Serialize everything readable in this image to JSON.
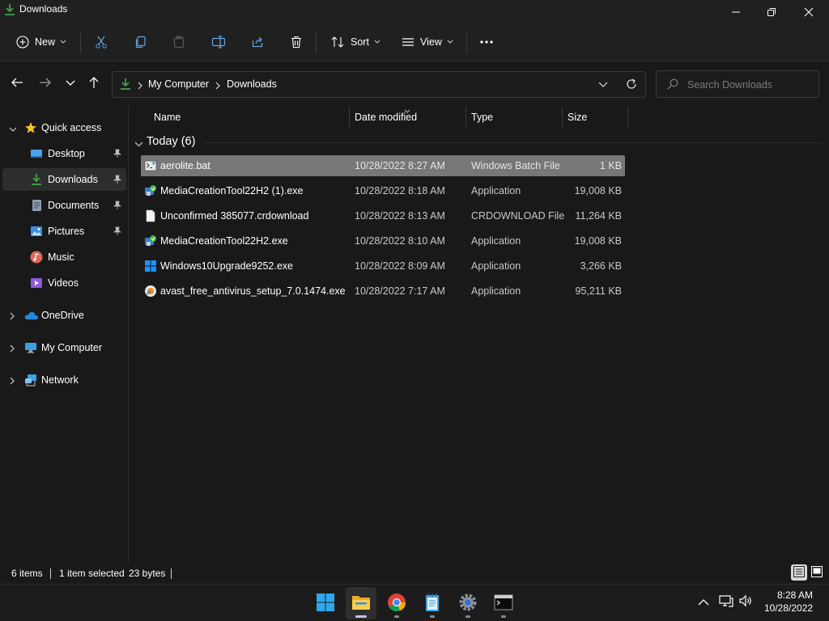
{
  "window": {
    "title": "Downloads"
  },
  "toolbar": {
    "new_label": "New",
    "sort_label": "Sort",
    "view_label": "View"
  },
  "address": {
    "crumbs": [
      "My Computer",
      "Downloads"
    ]
  },
  "search": {
    "placeholder": "Search Downloads"
  },
  "sidebar": {
    "quick_access": "Quick access",
    "items": [
      {
        "label": "Desktop",
        "icon": "desktop-icon",
        "pinned": true
      },
      {
        "label": "Downloads",
        "icon": "download-icon",
        "pinned": true,
        "selected": true
      },
      {
        "label": "Documents",
        "icon": "document-icon",
        "pinned": true
      },
      {
        "label": "Pictures",
        "icon": "pictures-icon",
        "pinned": true
      },
      {
        "label": "Music",
        "icon": "music-icon"
      },
      {
        "label": "Videos",
        "icon": "videos-icon"
      }
    ],
    "roots": [
      {
        "label": "OneDrive",
        "icon": "cloud-icon"
      },
      {
        "label": "My Computer",
        "icon": "computer-icon"
      },
      {
        "label": "Network",
        "icon": "network-icon"
      }
    ]
  },
  "columns": {
    "name": "Name",
    "date": "Date modified",
    "type": "Type",
    "size": "Size"
  },
  "group": {
    "label": "Today (6)"
  },
  "files": [
    {
      "name": "aerolite.bat",
      "date": "10/28/2022 8:27 AM",
      "type": "Windows Batch File",
      "size": "1 KB",
      "icon": "batch-file-icon",
      "selected": true
    },
    {
      "name": "MediaCreationTool22H2 (1).exe",
      "date": "10/28/2022 8:18 AM",
      "type": "Application",
      "size": "19,008 KB",
      "icon": "media-creation-tool-icon"
    },
    {
      "name": "Unconfirmed 385077.crdownload",
      "date": "10/28/2022 8:13 AM",
      "type": "CRDOWNLOAD File",
      "size": "11,264 KB",
      "icon": "blank-file-icon"
    },
    {
      "name": "MediaCreationTool22H2.exe",
      "date": "10/28/2022 8:10 AM",
      "type": "Application",
      "size": "19,008 KB",
      "icon": "media-creation-tool-icon"
    },
    {
      "name": "Windows10Upgrade9252.exe",
      "date": "10/28/2022 8:09 AM",
      "type": "Application",
      "size": "3,266 KB",
      "icon": "windows-logo-icon"
    },
    {
      "name": "avast_free_antivirus_setup_7.0.1474.exe",
      "date": "10/28/2022 7:17 AM",
      "type": "Application",
      "size": "95,211 KB",
      "icon": "installer-icon"
    }
  ],
  "status": {
    "items": "6 items",
    "selected": "1 item selected",
    "bytes": "23 bytes"
  },
  "taskbar": {
    "apps": [
      "start-icon",
      "file-explorer-icon",
      "chrome-icon",
      "notepad-icon",
      "settings-icon",
      "terminal-icon"
    ],
    "time": "8:28 AM",
    "date": "10/28/2022"
  },
  "colors": {
    "accent": "#3fa34d",
    "selection": "#777777",
    "background": "#191919"
  }
}
